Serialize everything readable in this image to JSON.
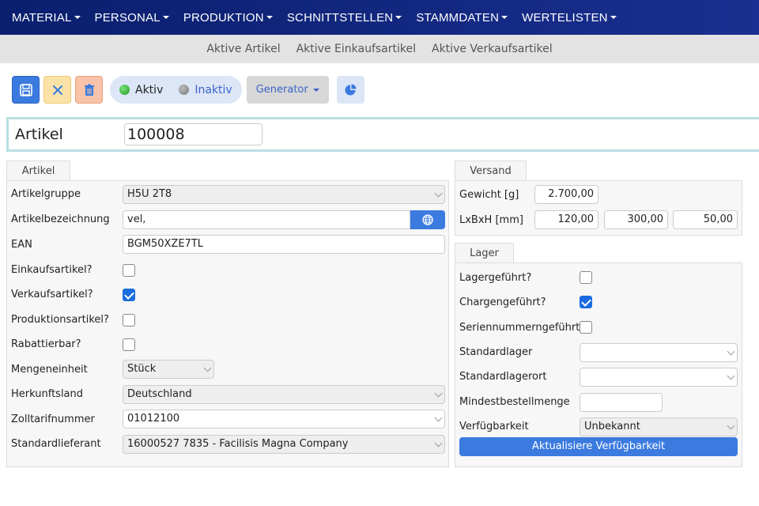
{
  "nav": {
    "items": [
      "MATERIAL",
      "PERSONAL",
      "PRODUKTION",
      "SCHNITTSTELLEN",
      "STAMMDATEN",
      "WERTELISTEN"
    ]
  },
  "subnav": {
    "items": [
      "Aktive Artikel",
      "Aktive Einkaufsartikel",
      "Aktive Verkaufsartikel"
    ]
  },
  "toolbar": {
    "aktiv": "Aktiv",
    "inaktiv": "Inaktiv",
    "generator": "Generator",
    "accent": "#3b7be0"
  },
  "header": {
    "label": "Artikel",
    "value": "100008"
  },
  "artikel": {
    "tab": "Artikel",
    "artikelgruppe_label": "Artikelgruppe",
    "artikelgruppe": "H5U 2T8",
    "bezeichnung_label": "Artikelbezeichnung",
    "bezeichnung": "vel,",
    "ean_label": "EAN",
    "ean": "BGM50XZE7TL",
    "einkauf_label": "Einkaufsartikel?",
    "einkauf": false,
    "verkauf_label": "Verkaufsartikel?",
    "verkauf": true,
    "produktion_label": "Produktionsartikel?",
    "produktion": false,
    "rabatt_label": "Rabattierbar?",
    "rabatt": false,
    "mengeneinheit_label": "Mengeneinheit",
    "mengeneinheit": "Stück",
    "herkunft_label": "Herkunftsland",
    "herkunft": "Deutschland",
    "zoll_label": "Zolltarifnummer",
    "zoll": "01012100",
    "lieferant_label": "Standardlieferant",
    "lieferant": "16000527 7835 - Facilisis Magna Company"
  },
  "versand": {
    "tab": "Versand",
    "gewicht_label": "Gewicht [g]",
    "gewicht": "2.700,00",
    "lxbxh_label": "LxBxH [mm]",
    "l": "120,00",
    "b": "300,00",
    "h": "50,00"
  },
  "lager": {
    "tab": "Lager",
    "lagergefuehrt_label": "Lagergeführt?",
    "lagergefuehrt": false,
    "charge_label": "Chargengeführt?",
    "charge": true,
    "serien_label": "Seriennummerngeführt?",
    "serien": false,
    "standardlager_label": "Standardlager",
    "standardlager": "",
    "lagerort_label": "Standardlagerort",
    "lagerort": "",
    "mindest_label": "Mindestbestellmenge",
    "mindest": "",
    "verfuegbarkeit_label": "Verfügbarkeit",
    "verfuegbarkeit": "Unbekannt",
    "button": "Aktualisiere Verfügbarkeit"
  }
}
